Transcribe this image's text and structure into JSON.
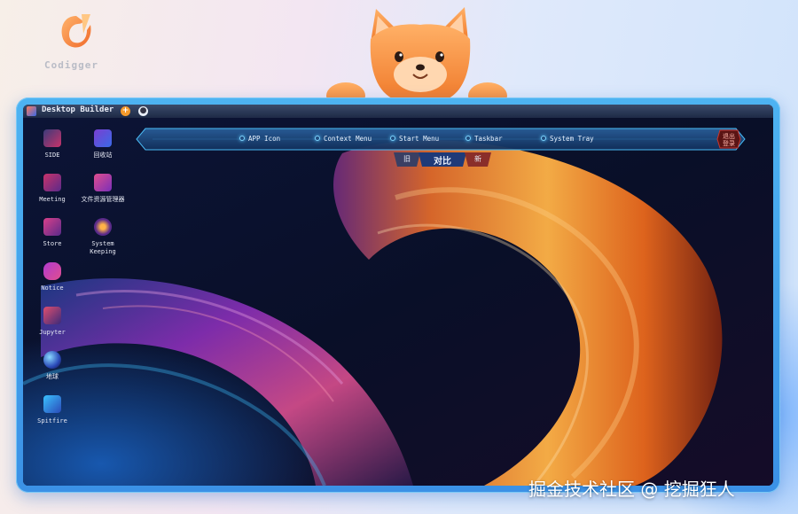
{
  "brand": {
    "name": "Codigger"
  },
  "window": {
    "title": "Desktop Builder",
    "add_button": "+",
    "nav_button": "●"
  },
  "nav": {
    "items": [
      "APP Icon",
      "Context Menu",
      "Start Menu",
      "Taskbar",
      "System Tray"
    ],
    "exit_label_line1": "退出",
    "exit_label_line2": "登录"
  },
  "compare": {
    "old": "旧",
    "label": "对比",
    "new": "新"
  },
  "desktop_icons": [
    {
      "label": "SIDE",
      "icon": "side-icon"
    },
    {
      "label": "回收站",
      "icon": "recycle-bin-icon"
    },
    {
      "label": "Meeting",
      "icon": "meeting-icon"
    },
    {
      "label": "文件资源管理器",
      "icon": "file-explorer-icon"
    },
    {
      "label": "Store",
      "icon": "store-icon"
    },
    {
      "label": "System\nKeeping",
      "icon": "system-keeping-icon"
    },
    {
      "label": "Notice",
      "icon": "notice-icon"
    },
    {
      "label": "Jupyter",
      "icon": "jupyter-icon"
    },
    {
      "label": "地球",
      "icon": "globe-icon"
    },
    {
      "label": "Spitfire",
      "icon": "spitfire-icon"
    }
  ],
  "watermark": "掘金技术社区 @ 挖掘狂人",
  "colors": {
    "accent_orange": "#f59a2b",
    "frame_blue": "#3b91e6",
    "nav_glow": "#5bc8ff",
    "exit_red": "#c8352c"
  }
}
